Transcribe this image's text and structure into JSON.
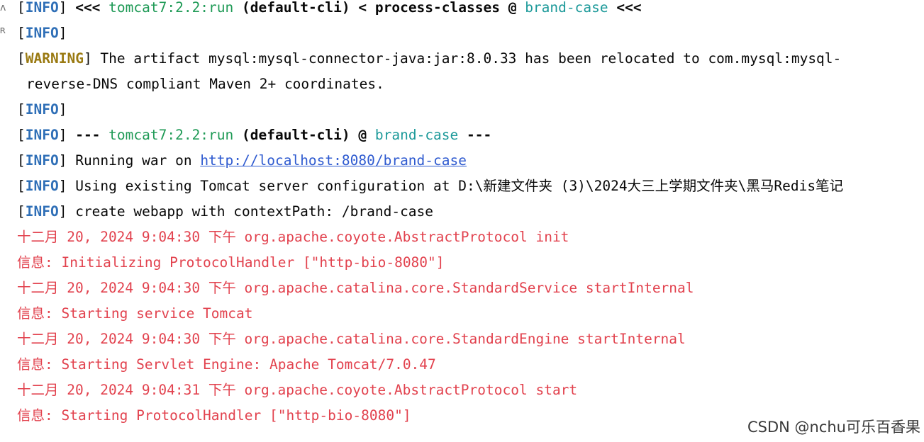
{
  "console": {
    "lines": [
      {
        "level": "INFO",
        "parts": [
          "<<< ",
          "tomcat7:2.2:run",
          " (default-cli) < process-classes @ ",
          "brand-case",
          " <<<"
        ]
      },
      {
        "level": "INFO"
      },
      {
        "level": "WARNING",
        "text": "The artifact mysql:mysql-connector-java:jar:8.0.33 has been relocated to com.mysql:mysql-"
      },
      {
        "text": "reverse-DNS compliant Maven 2+ coordinates."
      },
      {
        "level": "INFO"
      },
      {
        "level": "INFO",
        "parts": [
          "--- ",
          "tomcat7:2.2:run",
          " (default-cli) @ ",
          "brand-case",
          " ---"
        ]
      },
      {
        "level": "INFO",
        "text": "Running war on ",
        "link": "http://localhost:8080/brand-case"
      },
      {
        "level": "INFO",
        "text": "Using existing Tomcat server configuration at D:\\新建文件夹 (3)\\2024大三上学期文件夹\\黑马Redis笔记"
      },
      {
        "level": "INFO",
        "text": "create webapp with contextPath: /brand-case"
      },
      {
        "text": "十二月 20, 2024 9:04:30 下午 org.apache.coyote.AbstractProtocol init"
      },
      {
        "text": "信息: Initializing ProtocolHandler [\"http-bio-8080\"]"
      },
      {
        "text": "十二月 20, 2024 9:04:30 下午 org.apache.catalina.core.StandardService startInternal"
      },
      {
        "text": "信息: Starting service Tomcat"
      },
      {
        "text": "十二月 20, 2024 9:04:30 下午 org.apache.catalina.core.StandardEngine startInternal"
      },
      {
        "text": "信息: Starting Servlet Engine: Apache Tomcat/7.0.47"
      },
      {
        "text": "十二月 20, 2024 9:04:31 下午 org.apache.coyote.AbstractProtocol start"
      },
      {
        "text": "信息: Starting ProtocolHandler [\"http-bio-8080\"]"
      }
    ]
  },
  "gutter": {
    "marks": [
      "ʌ",
      "ʀ"
    ]
  },
  "watermark": "CSDN @nchu可乐百香果",
  "colors": {
    "info": "#2f6fb7",
    "warning": "#9a7a12",
    "goal": "#1f9a56",
    "project": "#1d9a9a",
    "link": "#2f5bd0",
    "stderr": "#e2424e"
  }
}
